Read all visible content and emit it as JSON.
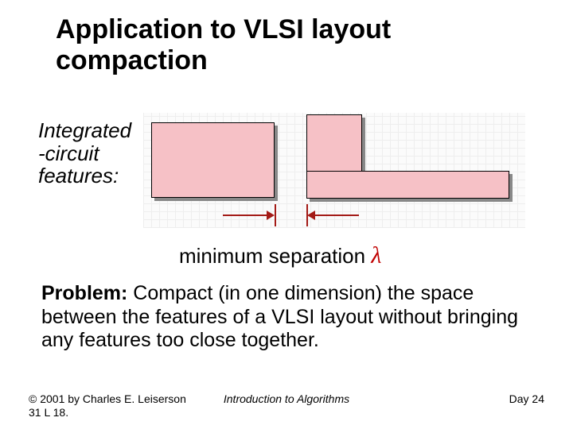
{
  "title_line1": "Application to VLSI layout",
  "title_line2": "compaction",
  "features_label_l1": "Integrated",
  "features_label_l2": "-circuit",
  "features_label_l3": "features:",
  "min_sep_text": "minimum separation",
  "lambda": "λ",
  "problem_lead": "Problem:",
  "problem_body": " Compact (in one dimension) the space between the features of a VLSI layout without bringing any features too close together.",
  "footer": {
    "copyright_l1": "© 2001 by Charles E. Leiserson",
    "copyright_l2": "31    L 18.",
    "center": "Introduction to Algorithms",
    "right": "Day   24"
  }
}
